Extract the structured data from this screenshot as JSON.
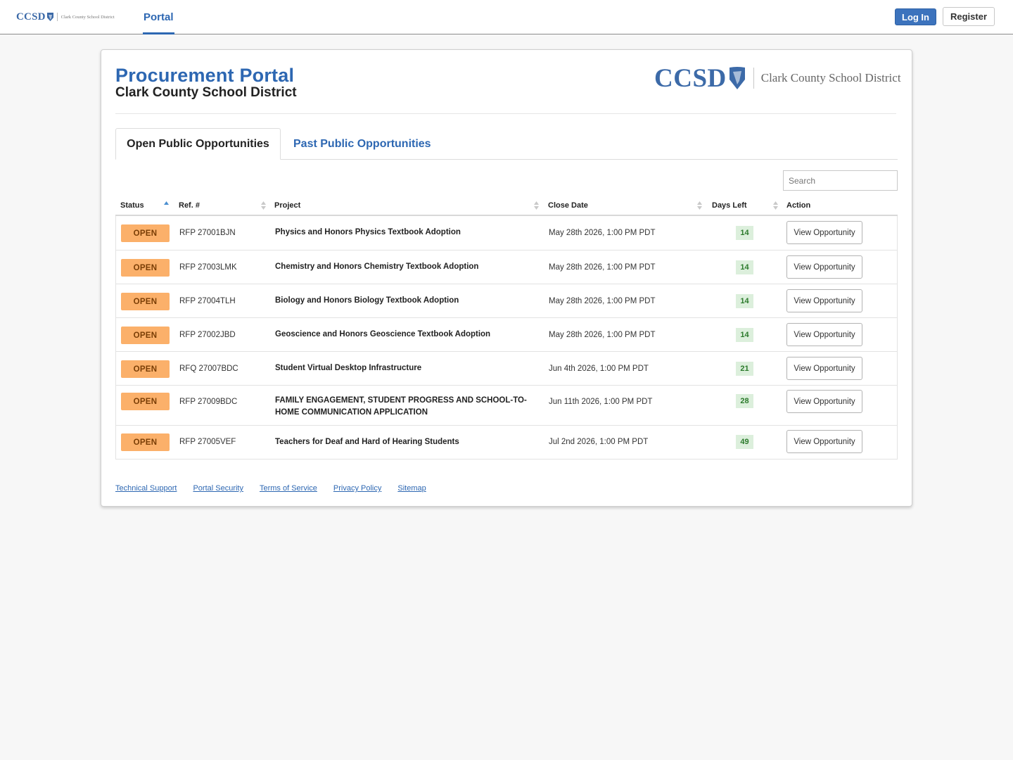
{
  "nav": {
    "logo_ccsd": "CCSD",
    "logo_district": "Clark County School District",
    "tab_portal": "Portal",
    "login_label": "Log In",
    "register_label": "Register"
  },
  "header": {
    "title": "Procurement Portal",
    "subtitle": "Clark County School District",
    "logo_ccsd": "CCSD",
    "logo_district": "Clark County School District"
  },
  "tabs": {
    "open": "Open Public Opportunities",
    "past": "Past Public Opportunities"
  },
  "search": {
    "placeholder": "Search"
  },
  "table": {
    "columns": {
      "status": "Status",
      "ref": "Ref. #",
      "project": "Project",
      "close_date": "Close Date",
      "days_left": "Days Left",
      "action": "Action"
    },
    "sorted_column": "status",
    "rows": [
      {
        "status": "OPEN",
        "ref": "RFP 27001BJN",
        "project": "Physics and Honors Physics Textbook Adoption",
        "close_date": "May 28th 2026, 1:00 PM PDT",
        "days_left": "14",
        "action": "View Opportunity"
      },
      {
        "status": "OPEN",
        "ref": "RFP 27003LMK",
        "project": "Chemistry and Honors Chemistry Textbook Adoption",
        "close_date": "May 28th 2026, 1:00 PM PDT",
        "days_left": "14",
        "action": "View Opportunity"
      },
      {
        "status": "OPEN",
        "ref": "RFP 27004TLH",
        "project": "Biology and Honors Biology Textbook Adoption",
        "close_date": "May 28th 2026, 1:00 PM PDT",
        "days_left": "14",
        "action": "View Opportunity"
      },
      {
        "status": "OPEN",
        "ref": "RFP 27002JBD",
        "project": "Geoscience and Honors Geoscience Textbook Adoption",
        "close_date": "May 28th 2026, 1:00 PM PDT",
        "days_left": "14",
        "action": "View Opportunity"
      },
      {
        "status": "OPEN",
        "ref": "RFQ 27007BDC",
        "project": "Student Virtual Desktop Infrastructure",
        "close_date": "Jun 4th 2026, 1:00 PM PDT",
        "days_left": "21",
        "action": "View Opportunity"
      },
      {
        "status": "OPEN",
        "ref": "RFP 27009BDC",
        "project": "FAMILY ENGAGEMENT, STUDENT PROGRESS AND SCHOOL-TO-HOME COMMUNICATION APPLICATION",
        "close_date": "Jun 11th 2026, 1:00 PM PDT",
        "days_left": "28",
        "action": "View Opportunity"
      },
      {
        "status": "OPEN",
        "ref": "RFP 27005VEF",
        "project": "Teachers for Deaf and Hard of Hearing Students",
        "close_date": "Jul 2nd 2026, 1:00 PM PDT",
        "days_left": "49",
        "action": "View Opportunity"
      }
    ]
  },
  "footer": {
    "links": [
      "Technical Support",
      "Portal Security",
      "Terms of Service",
      "Privacy Policy",
      "Sitemap"
    ]
  },
  "colors": {
    "brand_blue": "#2d67b2",
    "open_badge": "#fbb06a",
    "days_left_bg": "#dcefdc",
    "days_left_text": "#2b7a2b"
  }
}
